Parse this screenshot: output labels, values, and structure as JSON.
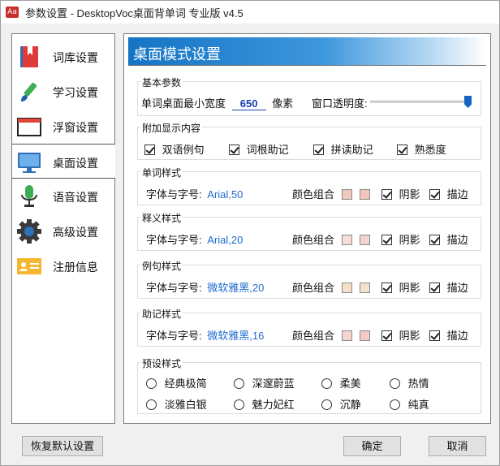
{
  "window": {
    "title": "参数设置 - DesktopVoc桌面背单词 专业版 v4.5",
    "app_icon_text": "Aa"
  },
  "sidebar": {
    "items": [
      {
        "label": "词库设置",
        "icon": "bookmark-book-icon"
      },
      {
        "label": "学习设置",
        "icon": "brush-icon"
      },
      {
        "label": "浮窗设置",
        "icon": "window-icon"
      },
      {
        "label": "桌面设置",
        "icon": "monitor-icon",
        "active": true
      },
      {
        "label": "语音设置",
        "icon": "microphone-icon"
      },
      {
        "label": "高级设置",
        "icon": "gear-icon"
      },
      {
        "label": "注册信息",
        "icon": "id-card-icon"
      }
    ]
  },
  "main": {
    "banner_title": "桌面模式设置",
    "basic": {
      "title": "基本参数",
      "min_width_label": "单词桌面最小宽度",
      "min_width_value": "650",
      "unit": "像素",
      "opacity_label": "窗口透明度:",
      "opacity_fraction": 0.98
    },
    "extra": {
      "title": "附加显示内容",
      "options": [
        {
          "label": "双语例句",
          "checked": true
        },
        {
          "label": "词根助记",
          "checked": true
        },
        {
          "label": "拼读助记",
          "checked": true
        },
        {
          "label": "熟悉度",
          "checked": true
        }
      ]
    },
    "styles": [
      {
        "title": "单词样式",
        "font_label": "字体与字号:",
        "font_value": "Arial,50",
        "color_label": "颜色组合",
        "colors": [
          "#efc9bf",
          "#f2c6bc"
        ],
        "shadow_label": "阴影",
        "outline_label": "描边"
      },
      {
        "title": "释义样式",
        "font_label": "字体与字号:",
        "font_value": "Arial,20",
        "color_label": "颜色组合",
        "colors": [
          "#f7dcd9",
          "#f4d2d2"
        ],
        "shadow_label": "阴影",
        "outline_label": "描边"
      },
      {
        "title": "例句样式",
        "font_label": "字体与字号:",
        "font_value": "微软雅黑,20",
        "color_label": "颜色组合",
        "colors": [
          "#f8e0c8",
          "#f5e2cc"
        ],
        "shadow_label": "阴影",
        "outline_label": "描边"
      },
      {
        "title": "助记样式",
        "font_label": "字体与字号:",
        "font_value": "微软雅黑,16",
        "color_label": "颜色组合",
        "colors": [
          "#f6d5d0",
          "#f4cbc4"
        ],
        "shadow_label": "阴影",
        "outline_label": "描边"
      }
    ],
    "presets": {
      "title": "预设样式",
      "options": [
        "经典极简",
        "深邃蔚蓝",
        "柔美",
        "热情",
        "淡雅白银",
        "魅力妃红",
        "沉静",
        "纯真"
      ]
    }
  },
  "footer": {
    "restore_label": "恢复默认设置",
    "ok_label": "确定",
    "cancel_label": "取消"
  }
}
